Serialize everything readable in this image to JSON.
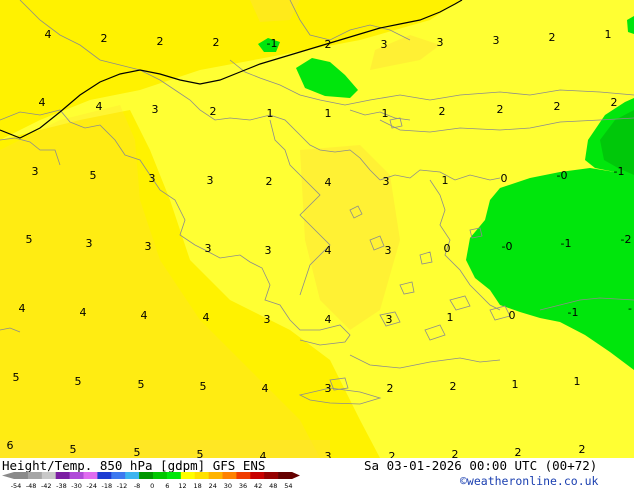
{
  "map": {
    "contour_labels": [
      {
        "t": "4",
        "c": "0-A"
      },
      {
        "t": "2",
        "c": "0-B"
      },
      {
        "t": "2",
        "c": "0-C"
      },
      {
        "t": "2",
        "c": "0-D"
      },
      {
        "t": "-1",
        "c": "0-E"
      },
      {
        "t": "2",
        "c": "0-F"
      },
      {
        "t": "3",
        "c": "0-G"
      },
      {
        "t": "3",
        "c": "0-H"
      },
      {
        "t": "3",
        "c": "0-I"
      },
      {
        "t": "2",
        "c": "0-J"
      },
      {
        "t": "1",
        "c": "0-K"
      },
      {
        "t": "4",
        "c": "1-A"
      },
      {
        "t": "4",
        "c": "1-B"
      },
      {
        "t": "3",
        "c": "1-C"
      },
      {
        "t": "2",
        "c": "1-D"
      },
      {
        "t": "1",
        "c": "1-E"
      },
      {
        "t": "1",
        "c": "1-F"
      },
      {
        "t": "1",
        "c": "1-G"
      },
      {
        "t": "2",
        "c": "1-H"
      },
      {
        "t": "2",
        "c": "1-I"
      },
      {
        "t": "2",
        "c": "1-J"
      },
      {
        "t": "2",
        "c": "1-K"
      },
      {
        "t": "3",
        "c": "2-A"
      },
      {
        "t": "5",
        "c": "2-B"
      },
      {
        "t": "3",
        "c": "2-C"
      },
      {
        "t": "3",
        "c": "2-D"
      },
      {
        "t": "2",
        "c": "2-E"
      },
      {
        "t": "4",
        "c": "2-F"
      },
      {
        "t": "3",
        "c": "2-G"
      },
      {
        "t": "1",
        "c": "2-H"
      },
      {
        "t": "0",
        "c": "2-I"
      },
      {
        "t": "-0",
        "c": "2-J"
      },
      {
        "t": "-1",
        "c": "2-K"
      },
      {
        "t": "5",
        "c": "3-A"
      },
      {
        "t": "3",
        "c": "3-B"
      },
      {
        "t": "3",
        "c": "3-C"
      },
      {
        "t": "3",
        "c": "3-D"
      },
      {
        "t": "3",
        "c": "3-E"
      },
      {
        "t": "4",
        "c": "3-F"
      },
      {
        "t": "3",
        "c": "3-G"
      },
      {
        "t": "0",
        "c": "3-H"
      },
      {
        "t": "-0",
        "c": "3-I"
      },
      {
        "t": "-1",
        "c": "3-J"
      },
      {
        "t": "-2",
        "c": "3-K"
      },
      {
        "t": "4",
        "c": "4-A"
      },
      {
        "t": "4",
        "c": "4-B"
      },
      {
        "t": "4",
        "c": "4-C"
      },
      {
        "t": "4",
        "c": "4-D"
      },
      {
        "t": "3",
        "c": "4-E"
      },
      {
        "t": "4",
        "c": "4-F"
      },
      {
        "t": "3",
        "c": "4-G"
      },
      {
        "t": "1",
        "c": "4-H"
      },
      {
        "t": "0",
        "c": "4-I"
      },
      {
        "t": "-1",
        "c": "4-J"
      },
      {
        "t": "-",
        "c": "4-K"
      },
      {
        "t": "5",
        "c": "5-A"
      },
      {
        "t": "5",
        "c": "5-B"
      },
      {
        "t": "5",
        "c": "5-C"
      },
      {
        "t": "5",
        "c": "5-D"
      },
      {
        "t": "4",
        "c": "5-E"
      },
      {
        "t": "3",
        "c": "5-F"
      },
      {
        "t": "2",
        "c": "5-G"
      },
      {
        "t": "2",
        "c": "5-H"
      },
      {
        "t": "1",
        "c": "5-I"
      },
      {
        "t": "1",
        "c": "5-J"
      },
      {
        "t": "6",
        "c": "6-A"
      },
      {
        "t": "5",
        "c": "6-B"
      },
      {
        "t": "5",
        "c": "6-C"
      },
      {
        "t": "5",
        "c": "6-D"
      },
      {
        "t": "4",
        "c": "6-E"
      },
      {
        "t": "3",
        "c": "6-F"
      },
      {
        "t": "2",
        "c": "6-G"
      },
      {
        "t": "2",
        "c": "6-H"
      },
      {
        "t": "2",
        "c": "6-I"
      },
      {
        "t": "2",
        "c": "6-J"
      }
    ],
    "colors": {
      "yellow_light": "#ffff33",
      "yellow_mid": "#fff000",
      "orange_patch": "#ffe135",
      "green": "#00e60c",
      "green_dark": "#00c80a",
      "coast": "#8c8c8c",
      "contour": "#000000"
    }
  },
  "footer": {
    "title": "Height/Temp. 850 hPa [gdpm] GFS ENS",
    "datetime": "Sa 03-01-2026 00:00 UTC (00+72)",
    "credit": "©weatheronline.co.uk",
    "scale_ticks": [
      "-54",
      "-48",
      "-42",
      "-38",
      "-30",
      "-24",
      "-18",
      "-12",
      "-8",
      "0",
      "6",
      "12",
      "18",
      "24",
      "30",
      "36",
      "42",
      "48",
      "54"
    ],
    "scale_colors": [
      "#8a8a8a",
      "#a6a6a6",
      "#c8c8c8",
      "#7c1ea3",
      "#b04ad8",
      "#e06cf0",
      "#1e3cd2",
      "#3c78f0",
      "#3cb4f0",
      "#009600",
      "#00c800",
      "#00e60c",
      "#ffff00",
      "#ffe100",
      "#ffb400",
      "#ff8200",
      "#f03c00",
      "#c80000",
      "#960000",
      "#640000"
    ]
  }
}
